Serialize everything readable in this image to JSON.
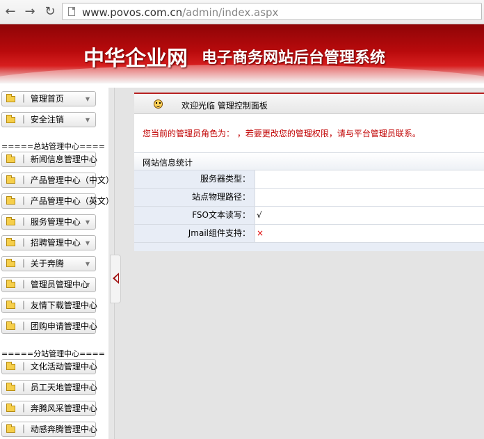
{
  "browser": {
    "back_icon": "arrow-left-icon",
    "forward_icon": "arrow-right-icon",
    "reload_icon": "reload-icon",
    "url_host": "www.povos.com.cn",
    "url_path": "/admin/index.aspx"
  },
  "banner": {
    "title": "中华企业网",
    "subtitle": "电子商务网站后台管理系统"
  },
  "sidebar": {
    "top_items": [
      "｜ 管理首页",
      "｜ 安全注销"
    ],
    "group1_title": "=====总站管理中心====",
    "group1_items": [
      "｜ 新闻信息管理中心",
      "｜ 产品管理中心（中文）",
      "｜ 产品管理中心（英文）",
      "｜ 服务管理中心",
      "｜ 招聘管理中心",
      "｜ 关于奔腾",
      "｜ 管理员管理中心",
      "｜ 友情下载管理中心",
      "｜ 团购申请管理中心"
    ],
    "group2_title": "=====分站管理中心====",
    "group2_items": [
      "｜ 文化活动管理中心",
      "｜ 员工天地管理中心",
      "｜ 奔腾风采管理中心",
      "｜ 动感奔腾管理中心"
    ]
  },
  "panel": {
    "header": "欢迎光临 管理控制面板",
    "notice": "您当前的管理员角色为： ，若要更改您的管理权限，请与平台管理员联系。",
    "section_title": "网站信息统计",
    "rows": [
      {
        "label": "服务器类型：",
        "value": ""
      },
      {
        "label": "站点物理路径：",
        "value": ""
      },
      {
        "label": "FSO文本读写：",
        "value": "√"
      },
      {
        "label": "Jmail组件支持：",
        "value": "×"
      }
    ]
  },
  "colors": {
    "banner_red": "#b80a0c",
    "notice_red": "#c00000",
    "label_bg": "#e8edf6"
  }
}
